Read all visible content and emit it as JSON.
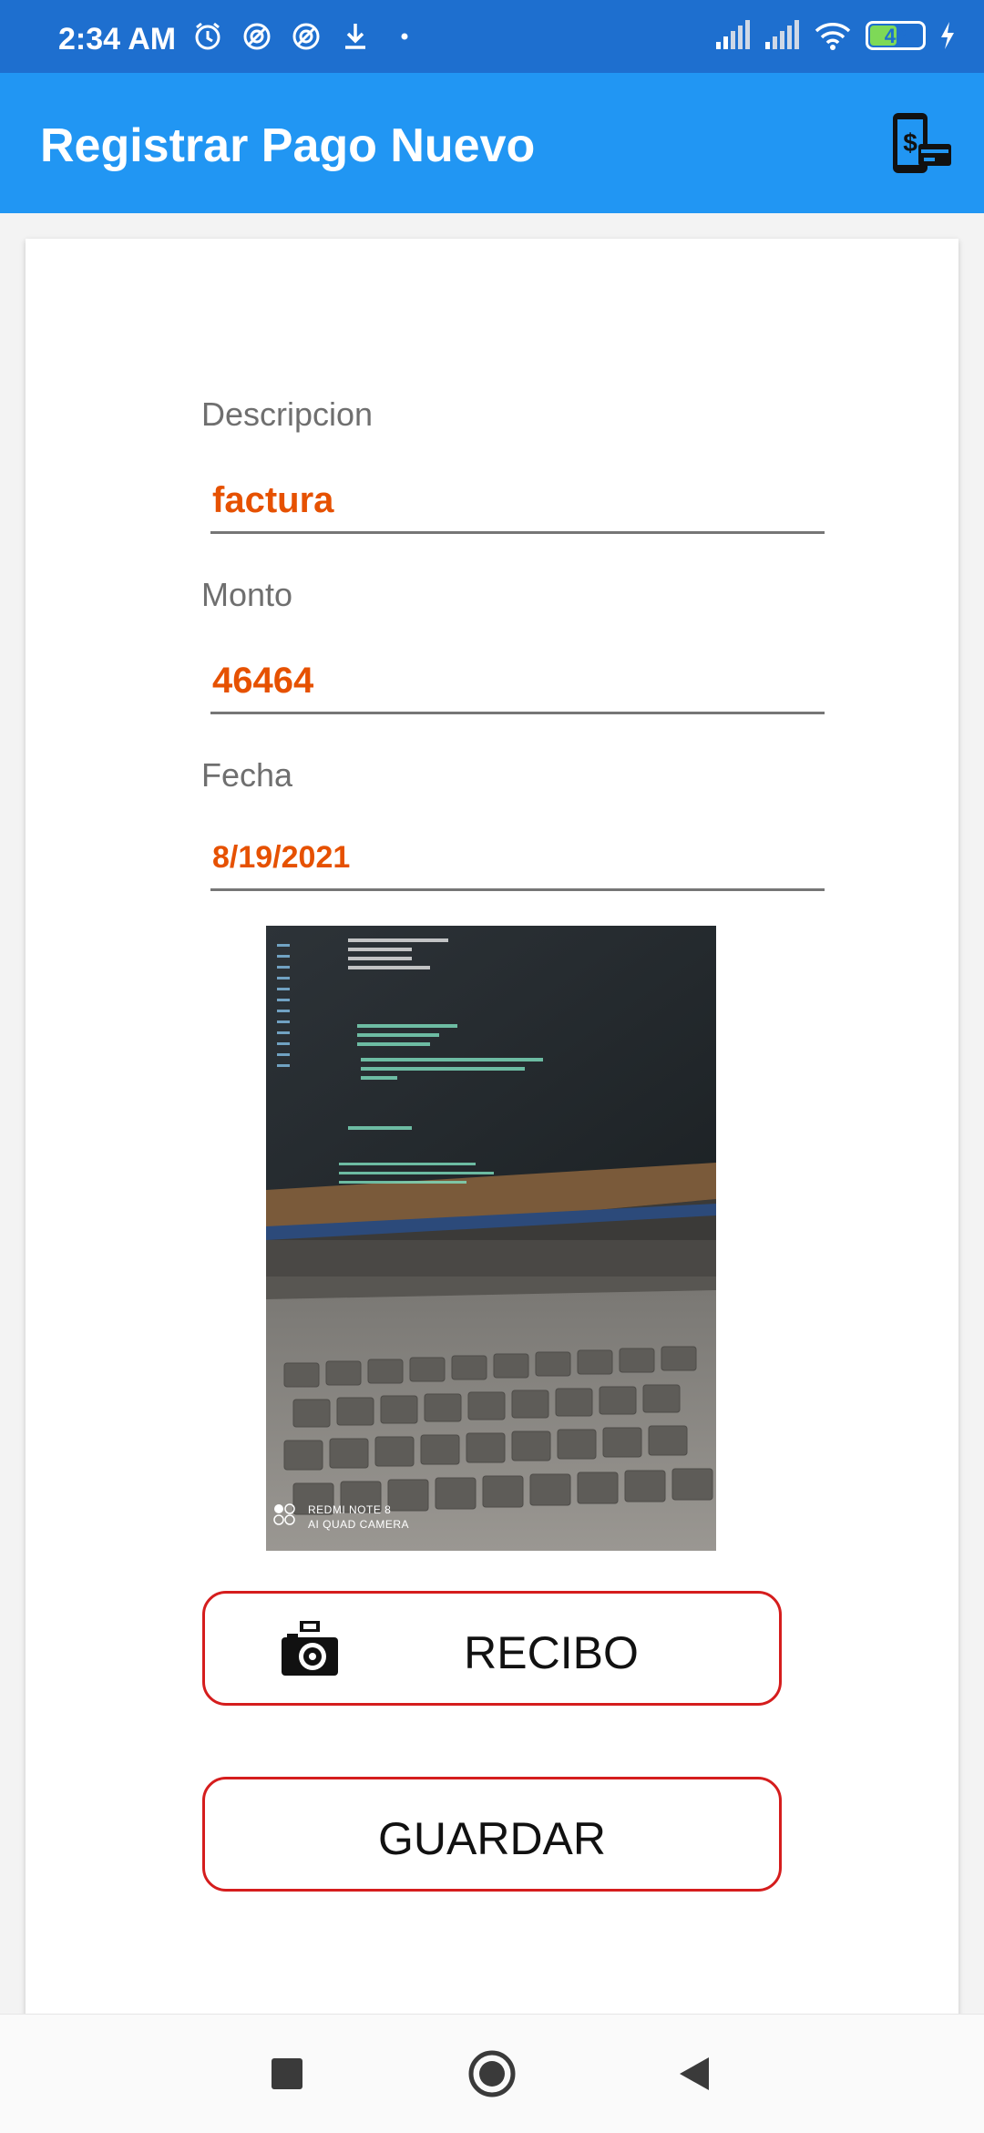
{
  "status_bar": {
    "time": "2:34 AM",
    "battery": "48",
    "icons": [
      "alarm-icon",
      "sync-icon",
      "sync-icon",
      "download-icon",
      "dot-icon",
      "signal-icon",
      "signal-icon",
      "wifi-icon",
      "battery-icon",
      "charging-icon"
    ]
  },
  "appbar": {
    "title": "Registrar Pago Nuevo",
    "action_icon": "mobile-payment-icon"
  },
  "form": {
    "descripcion_label": "Descripcion",
    "descripcion_value": "factura",
    "monto_label": "Monto",
    "monto_value": "46464",
    "fecha_label": "Fecha",
    "fecha_value": "8/19/2021"
  },
  "photo": {
    "watermark_line1": "REDMI NOTE 8",
    "watermark_line2": "AI QUAD CAMERA"
  },
  "buttons": {
    "recibo_label": "RECIBO",
    "guardar_label": "GUARDAR"
  },
  "colors": {
    "status_bar": "#1e6fcf",
    "appbar": "#2196f3",
    "input_text": "#e65100",
    "button_border": "#d51d1d"
  }
}
